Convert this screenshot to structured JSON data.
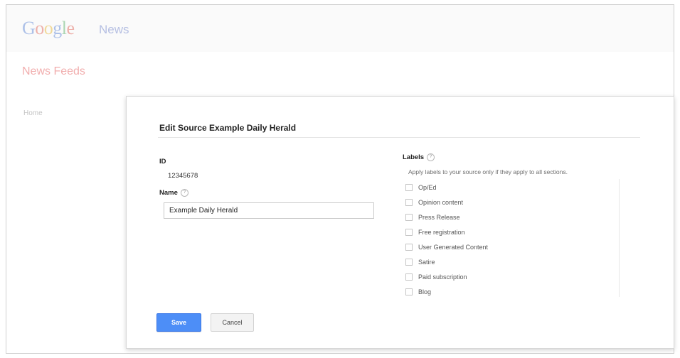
{
  "header": {
    "logo_text": "Google",
    "product_name": "News"
  },
  "page": {
    "section_title": "News Feeds",
    "nav_item": "Home"
  },
  "dialog": {
    "title": "Edit Source Example Daily Herald",
    "id_label": "ID",
    "id_value": "12345678",
    "name_label": "Name",
    "name_value": "Example Daily Herald",
    "labels_label": "Labels",
    "labels_hint": "Apply labels to your source only if they apply to all sections.",
    "help_glyph": "?",
    "labels": [
      {
        "label": "Op/Ed",
        "checked": false
      },
      {
        "label": "Opinion content",
        "checked": false
      },
      {
        "label": "Press Release",
        "checked": false
      },
      {
        "label": "Free registration",
        "checked": false
      },
      {
        "label": "User Generated Content",
        "checked": false
      },
      {
        "label": "Satire",
        "checked": false
      },
      {
        "label": "Paid subscription",
        "checked": false
      },
      {
        "label": "Blog",
        "checked": false
      }
    ],
    "save_label": "Save",
    "cancel_label": "Cancel"
  },
  "colors": {
    "primary_button": "#4d8ef7",
    "section_title": "#e24b4b"
  }
}
